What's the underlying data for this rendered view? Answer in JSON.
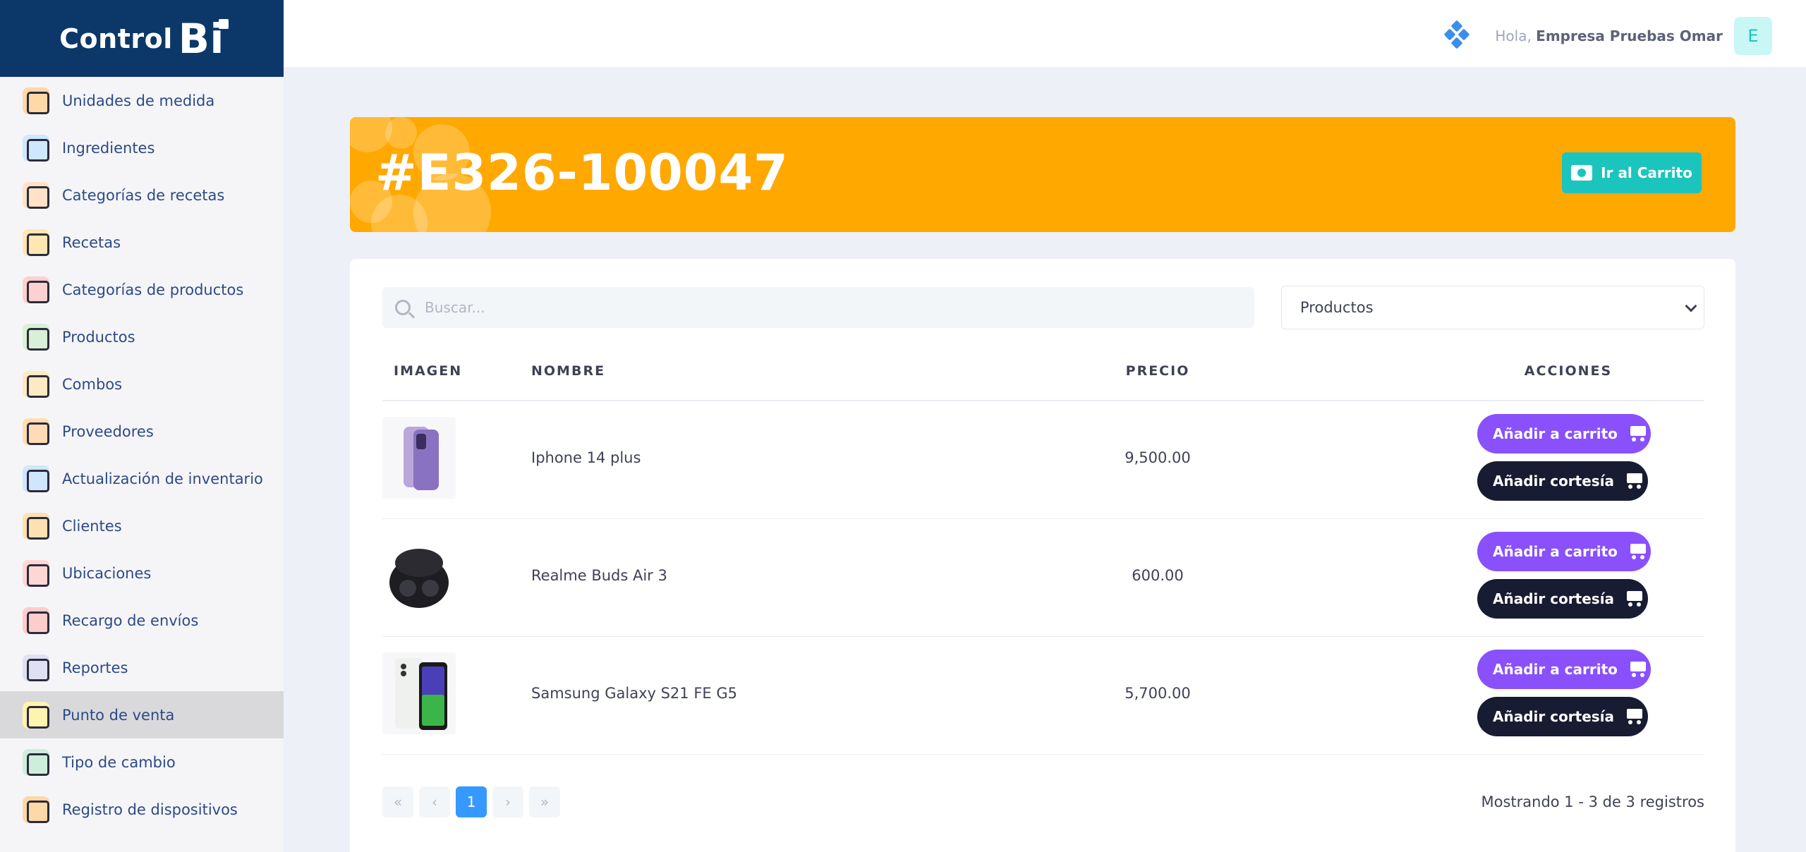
{
  "brand": {
    "name": "Control",
    "suffix": "Bi"
  },
  "sidebar": {
    "items": [
      {
        "label": "Unidades de medida",
        "color": "#ffd8a8"
      },
      {
        "label": "Ingredientes",
        "color": "#d0e8ff"
      },
      {
        "label": "Categorías de recetas",
        "color": "#ffe2c7"
      },
      {
        "label": "Recetas",
        "color": "#ffe6b3"
      },
      {
        "label": "Categorías de productos",
        "color": "#ffd0d0"
      },
      {
        "label": "Productos",
        "color": "#d7f0d7"
      },
      {
        "label": "Combos",
        "color": "#ffe9c2"
      },
      {
        "label": "Proveedores",
        "color": "#ffdcb5"
      },
      {
        "label": "Actualización de inventario",
        "color": "#cfe6ff"
      },
      {
        "label": "Clientes",
        "color": "#ffe0b2"
      },
      {
        "label": "Ubicaciones",
        "color": "#ffd6d6"
      },
      {
        "label": "Recargo de envíos",
        "color": "#ffcccc"
      },
      {
        "label": "Reportes",
        "color": "#e0e0f5"
      },
      {
        "label": "Punto de venta",
        "color": "#fff3b0"
      },
      {
        "label": "Tipo de cambio",
        "color": "#cdeedd"
      },
      {
        "label": "Registro de dispositivos",
        "color": "#ffd8a8"
      }
    ],
    "active_index": 13
  },
  "header": {
    "greeting_prefix": "Hola,",
    "user_name": "Empresa Pruebas Omar",
    "avatar_letter": "E"
  },
  "order": {
    "title": "#E326-100047",
    "cart_button": "Ir al Carrito"
  },
  "filters": {
    "search_placeholder": "Buscar...",
    "category_select": "Productos"
  },
  "table": {
    "headers": {
      "image": "IMAGEN",
      "name": "NOMBRE",
      "price": "PRECIO",
      "actions": "ACCIONES"
    },
    "rows": [
      {
        "name": "Iphone 14 plus",
        "price": "9,500.00",
        "add_label": "Añadir a carrito",
        "courtesy_label": "Añadir cortesía"
      },
      {
        "name": "Realme Buds Air 3",
        "price": "600.00",
        "add_label": "Añadir a carrito",
        "courtesy_label": "Añadir cortesía"
      },
      {
        "name": "Samsung Galaxy S21 FE G5",
        "price": "5,700.00",
        "add_label": "Añadir a carrito",
        "courtesy_label": "Añadir cortesía"
      }
    ]
  },
  "pagination": {
    "first": "«",
    "prev": "‹",
    "current": "1",
    "next": "›",
    "last": "»",
    "summary": "Mostrando 1 - 3 de 3 registros"
  },
  "colors": {
    "banner": "#ffa800",
    "primary_purple": "#8950fc",
    "dark": "#181c32",
    "teal": "#1bc5bd",
    "brand_blue": "#0c3869",
    "page_blue": "#3699ff"
  }
}
